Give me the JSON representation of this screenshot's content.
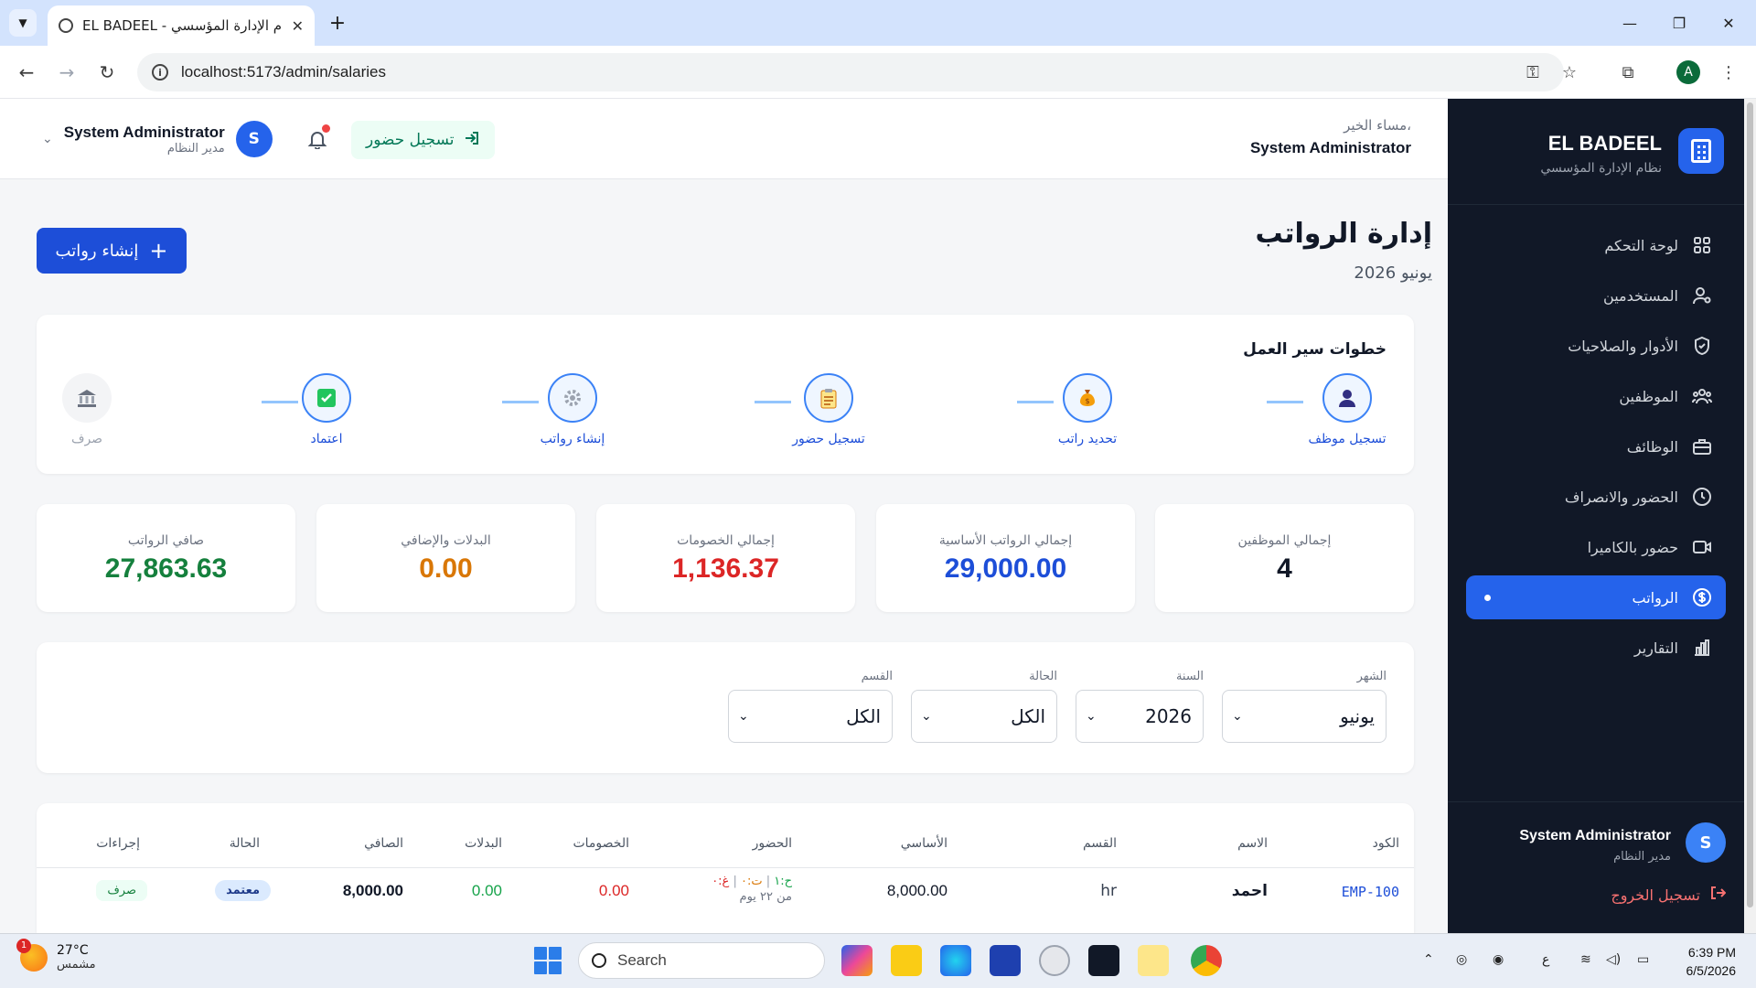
{
  "browser": {
    "tab_title": "EL BADEEL - نظام الإدارة المؤسسي",
    "url": "localhost:5173/admin/salaries",
    "profile_initial": "A"
  },
  "sidebar": {
    "brand_name": "EL BADEEL",
    "brand_sub": "نظام الإدارة المؤسسي",
    "items": [
      {
        "label": "لوحة التحكم",
        "icon": "grid-icon"
      },
      {
        "label": "المستخدمين",
        "icon": "user-settings-icon"
      },
      {
        "label": "الأدوار والصلاحيات",
        "icon": "shield-icon"
      },
      {
        "label": "الموظفين",
        "icon": "users-icon"
      },
      {
        "label": "الوظائف",
        "icon": "briefcase-icon"
      },
      {
        "label": "الحضور والانصراف",
        "icon": "clock-icon"
      },
      {
        "label": "حضور بالكاميرا",
        "icon": "camera-icon"
      },
      {
        "label": "الرواتب",
        "icon": "dollar-icon"
      },
      {
        "label": "التقارير",
        "icon": "bar-chart-icon"
      }
    ],
    "active_index": 7,
    "user_initial": "S",
    "user_name": "System Administrator",
    "user_role": "مدير النظام",
    "logout_label": "تسجيل الخروج"
  },
  "header": {
    "greeting": "مساء الخير،",
    "greeting_name": "System Administrator",
    "checkin_label": "تسجيل حضور",
    "user_name": "System Administrator",
    "user_role": "مدير النظام",
    "user_initial": "S"
  },
  "page": {
    "title": "إدارة الرواتب",
    "subtitle": "يونيو 2026",
    "create_label": "إنشاء رواتب"
  },
  "workflow": {
    "title": "خطوات سير العمل",
    "steps": [
      {
        "label": "تسجيل موظف",
        "icon": "person-icon",
        "emoji": "👤"
      },
      {
        "label": "تحديد راتب",
        "icon": "money-bag-icon",
        "emoji": "💰"
      },
      {
        "label": "تسجيل حضور",
        "icon": "clipboard-icon",
        "emoji": "📋"
      },
      {
        "label": "إنشاء رواتب",
        "icon": "gear-icon",
        "emoji": "⚙️"
      },
      {
        "label": "اعتماد",
        "icon": "check-box-icon",
        "emoji": "✅"
      },
      {
        "label": "صرف",
        "icon": "bank-icon",
        "emoji": "🏦"
      }
    ]
  },
  "stats": [
    {
      "label": "إجمالي الموظفين",
      "value": "4",
      "color": "#111827"
    },
    {
      "label": "إجمالي الرواتب الأساسية",
      "value": "29,000.00",
      "color": "#1d4ed8"
    },
    {
      "label": "إجمالي الخصومات",
      "value": "1,136.37",
      "color": "#dc2626"
    },
    {
      "label": "البدلات والإضافي",
      "value": "0.00",
      "color": "#d97706"
    },
    {
      "label": "صافي الرواتب",
      "value": "27,863.63",
      "color": "#15803d"
    }
  ],
  "filters": {
    "month": {
      "label": "الشهر",
      "value": "يونيو"
    },
    "year": {
      "label": "السنة",
      "value": "2026"
    },
    "status": {
      "label": "الحالة",
      "value": "الكل"
    },
    "department": {
      "label": "القسم",
      "value": "الكل"
    }
  },
  "table": {
    "headers": {
      "code": "الكود",
      "name": "الاسم",
      "department": "القسم",
      "basic": "الأساسي",
      "attendance": "الحضور",
      "deductions": "الخصومات",
      "allowances": "البدلات",
      "net": "الصافي",
      "status": "الحالة",
      "actions": "إجراءات"
    },
    "rows": [
      {
        "code": "EMP-100",
        "name": "احمد",
        "department": "hr",
        "basic": "8,000.00",
        "att_present": "ح:١",
        "att_late": "ت:٠",
        "att_absent": "غ:٠",
        "att_days": "من ٢٢ يوم",
        "deductions": "0.00",
        "allowances": "0.00",
        "net": "8,000.00",
        "status": "معتمد",
        "action": "صرف"
      }
    ]
  },
  "taskbar": {
    "temp": "27°C",
    "condition": "مشمس",
    "weather_badge": "1",
    "search": "Search",
    "lang": "ع",
    "time": "6:39 PM",
    "date": "6/5/2026"
  }
}
